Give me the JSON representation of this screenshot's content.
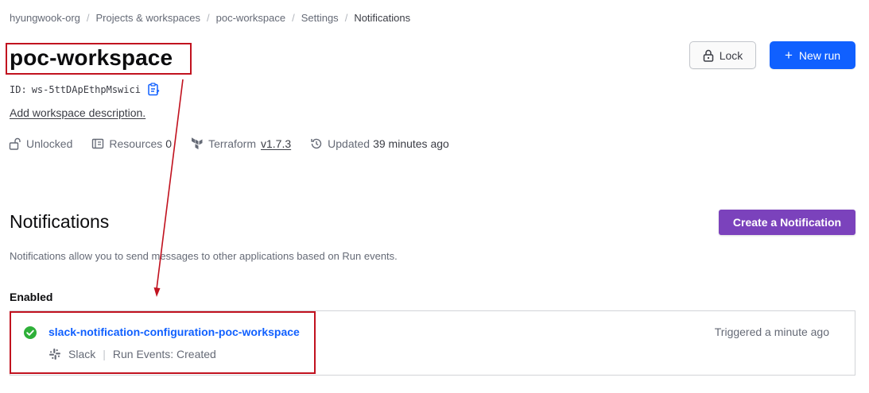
{
  "breadcrumb": {
    "items": [
      {
        "label": "hyungwook-org"
      },
      {
        "label": "Projects & workspaces"
      },
      {
        "label": "poc-workspace"
      },
      {
        "label": "Settings"
      },
      {
        "label": "Notifications"
      }
    ],
    "separator": "/"
  },
  "workspace": {
    "title": "poc-workspace",
    "id_label": "ID:",
    "id_value": "ws-5ttDApEthpMswici",
    "add_description": "Add workspace description."
  },
  "header_actions": {
    "lock_label": "Lock",
    "new_run_label": "New run",
    "new_run_icon": "+"
  },
  "meta": {
    "lock_status": "Unlocked",
    "resources_label": "Resources",
    "resources_count": "0",
    "terraform_label": "Terraform",
    "terraform_version": "v1.7.3",
    "updated_label": "Updated",
    "updated_value": "39 minutes ago"
  },
  "notifications": {
    "title": "Notifications",
    "create_button": "Create a Notification",
    "description": "Notifications allow you to send messages to other applications based on Run events.",
    "enabled_heading": "Enabled",
    "items": [
      {
        "name": "slack-notification-configuration-poc-workspace",
        "destination": "Slack",
        "separator": "|",
        "events": "Run Events: Created",
        "triggered": "Triggered a minute ago",
        "status_icon": "check-circle-icon"
      }
    ]
  },
  "colors": {
    "primary_blue": "#1060ff",
    "create_purple": "#7b42bc",
    "success_green": "#2eb039",
    "annotation_red": "#c1121f"
  }
}
